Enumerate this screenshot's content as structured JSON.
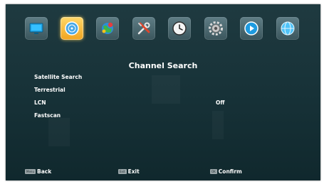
{
  "icons": [
    {
      "name": "tv-icon",
      "active": false
    },
    {
      "name": "disc-search-icon",
      "active": true
    },
    {
      "name": "globe-apps-icon",
      "active": false
    },
    {
      "name": "tools-icon",
      "active": false
    },
    {
      "name": "clock-icon",
      "active": false
    },
    {
      "name": "settings-gear-icon",
      "active": false
    },
    {
      "name": "play-icon",
      "active": false
    },
    {
      "name": "network-globe-icon",
      "active": false
    }
  ],
  "title": "Channel Search",
  "menu": [
    {
      "label": "Satellite Search",
      "value": ""
    },
    {
      "label": "Terrestrial",
      "value": ""
    },
    {
      "label": "LCN",
      "value": "Off"
    },
    {
      "label": "Fastscan",
      "value": ""
    }
  ],
  "footer": {
    "back": {
      "key": "Menu",
      "label": "Back"
    },
    "exit": {
      "key": "Exit",
      "label": "Exit"
    },
    "confirm": {
      "key": "OK",
      "label": "Confirm"
    }
  },
  "colors": {
    "background": "#173238",
    "active_tile": "#f0a420",
    "tile": "#4a666d",
    "text": "#ffffff"
  }
}
